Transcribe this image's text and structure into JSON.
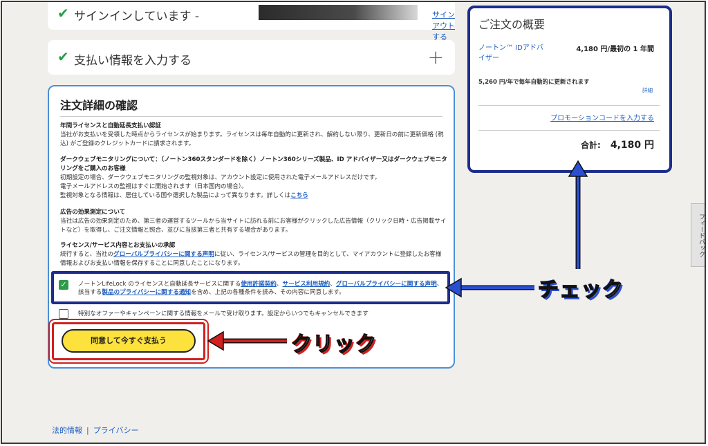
{
  "signed_in": {
    "text": "サインインしています -",
    "signout": "サインアウトする"
  },
  "payment": {
    "text": "支払い情報を入力する",
    "expand": "+"
  },
  "details": {
    "title": "注文詳細の確認",
    "sections": [
      {
        "heading": "年間ライセンスと自動延長支払い認証",
        "body": "当社がお支払いを受領した時点からライセンスが始まります。ライセンスは毎年自動的に更新され、解約しない限り、更新日の前に更新価格 (税込) がご登録のクレジットカードに請求されます。"
      },
      {
        "heading": "ダークウェブモニタリングについて：（ノートン360スタンダードを除く）ノートン360シリーズ製品、ID アドバイザー又はダークウェブモニタリングをご購入のお客様",
        "body1": "初期設定の場合、ダークウェブモニタリングの監視対象は、アカウント設定に使用された電子メールアドレスだけです。",
        "body2": "電子メールアドレスの監視はすぐに開始されます（日本国内の場合）。",
        "body3": "監視対象となる情報は、居住している国や選択した製品によって異なります。詳しくは",
        "link": "こちら"
      },
      {
        "heading": "広告の効果測定について",
        "body": "当社は広告の効果測定のため、第三者の運営するツールから当サイトに訪れる前にお客様がクリックした広告情報（クリック日時・広告掲載サイトなど）を取得し、ご注文情報と照合、並びに当該第三者と共有する場合があります。"
      },
      {
        "heading": "ライセンス/サービス内容とお支払いの承認",
        "body_pre": "続行すると、当社の",
        "link": "グローバルプライバシー",
        "link2": "に関する声明",
        "body_post": "に従い、ライセンス/サービスの管理を目的として、マイアカウントに登録したお客様情報およびお支払い情報を保存することに同意したことになります。"
      }
    ],
    "agree_checkbox": {
      "checked": true,
      "pre": "ノートンLifeLock のライセンスと自動延長サービスに関する",
      "link1": "使用許諾契約",
      "sep1": "、",
      "link2": "サービス利用規約",
      "sep2": "、",
      "link3": "グローバルプライバシーに関する声明",
      "mid": "、該当する",
      "link4": "製品のプライバシーに関する通知",
      "post": "を含め、上記の各種条件を読み、その内容に同意します。"
    },
    "offers_checkbox": {
      "checked": false,
      "text": "特別なオファーやキャンペーンに関する情報をメールで受け取ります。設定からいつでもキャンセルできます"
    },
    "pay_button": "同意して今すぐ支払う"
  },
  "summary": {
    "title": "ご注文の概要",
    "product": "ノートン™ IDアドバイザー",
    "price": "4,180 円/最初の 1 年間",
    "renewal": "5,260 円/年で毎年自動的に更新されます",
    "detail_link": "詳細",
    "promo_link": "プロモーションコードを入力する",
    "total_label": "合計:",
    "total_value": "4,180 円"
  },
  "feedback": "フィードバック",
  "annotations": {
    "check": "チェック",
    "click": "クリック",
    "check_color": "#2a4fd0",
    "click_color": "#d12020"
  },
  "footer": {
    "legal": "法的情報",
    "separator": "|",
    "privacy": "プライバシー"
  },
  "colors": {
    "accent_green": "#2e9b4a",
    "link_blue": "#1f5ec0",
    "button_yellow": "#fde23d",
    "highlight_navy": "#1c2d8c"
  }
}
